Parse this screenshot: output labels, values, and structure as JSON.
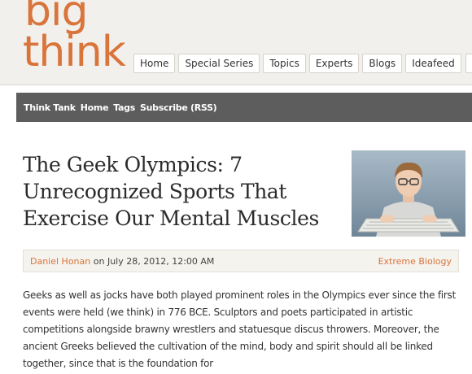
{
  "logo": {
    "line1": "big",
    "line2": "think"
  },
  "nav": {
    "items": [
      "Home",
      "Special Series",
      "Topics",
      "Experts",
      "Blogs",
      "Ideafeed"
    ]
  },
  "subnav": {
    "items": [
      "Think Tank",
      "Home",
      "Tags",
      "Subscribe (RSS)"
    ]
  },
  "article": {
    "title": "The Geek Olympics: 7 Unrecognized Sports That Exercise Our Mental Muscles",
    "author": "Daniel Honan",
    "date_text": " on July 28, 2012, 12:00 AM",
    "category": "Extreme Biology",
    "body": "Geeks as well as jocks have both played prominent roles in the Olympics ever since the first events were held (we think) in 776 BCE. Sculptors and poets participated in artistic competitions alongside brawny wrestlers and statuesque discus throwers. Moreover, the ancient Greeks believed the cultivation of the mind, body and spirit should all be linked together, since that is the foundation for"
  },
  "colors": {
    "brand_orange": "#d9743a",
    "subnav_bg": "#5d5d5d",
    "header_bg": "#f2f0ec"
  }
}
